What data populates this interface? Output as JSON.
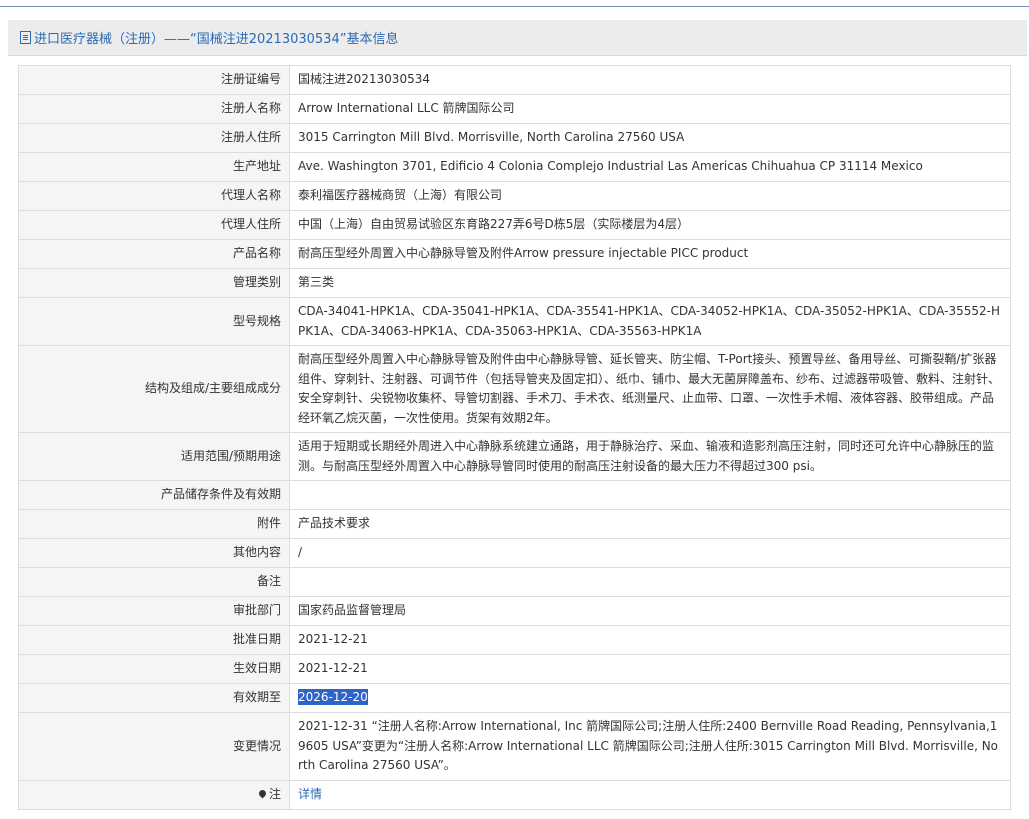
{
  "header": {
    "title": "进口医疗器械（注册）——“国械注进20213030534”基本信息"
  },
  "rows": [
    {
      "label": "注册证编号",
      "value": "国械注进20213030534"
    },
    {
      "label": "注册人名称",
      "value": "Arrow International LLC 箭牌国际公司"
    },
    {
      "label": "注册人住所",
      "value": "3015 Carrington Mill Blvd. Morrisville, North Carolina 27560 USA"
    },
    {
      "label": "生产地址",
      "value": "Ave. Washington 3701, Edificio 4 Colonia Complejo Industrial Las Americas Chihuahua CP 31114 Mexico"
    },
    {
      "label": "代理人名称",
      "value": "泰利福医疗器械商贸（上海）有限公司"
    },
    {
      "label": "代理人住所",
      "value": "中国（上海）自由贸易试验区东育路227弄6号D栋5层（实际楼层为4层）"
    },
    {
      "label": "产品名称",
      "value": "耐高压型经外周置入中心静脉导管及附件Arrow pressure injectable PICC product"
    },
    {
      "label": "管理类别",
      "value": "第三类"
    },
    {
      "label": "型号规格",
      "value": "CDA-34041-HPK1A、CDA-35041-HPK1A、CDA-35541-HPK1A、CDA-34052-HPK1A、CDA-35052-HPK1A、CDA-35552-HPK1A、CDA-34063-HPK1A、CDA-35063-HPK1A、CDA-35563-HPK1A"
    },
    {
      "label": "结构及组成/主要组成成分",
      "value": "耐高压型经外周置入中心静脉导管及附件由中心静脉导管、延长管夹、防尘帽、T-Port接头、预置导丝、备用导丝、可撕裂鞘/扩张器组件、穿刺针、注射器、可调节件（包括导管夹及固定扣）、纸巾、铺巾、最大无菌屏障盖布、纱布、过滤器带吸管、敷料、注射针、安全穿刺针、尖锐物收集杯、导管切割器、手术刀、手术衣、纸测量尺、止血带、口罩、一次性手术帽、液体容器、胶带组成。产品经环氧乙烷灭菌，一次性使用。货架有效期2年。"
    },
    {
      "label": "适用范围/预期用途",
      "value": "适用于短期或长期经外周进入中心静脉系统建立通路，用于静脉治疗、采血、输液和造影剂高压注射，同时还可允许中心静脉压的监测。与耐高压型经外周置入中心静脉导管同时使用的耐高压注射设备的最大压力不得超过300 psi。"
    },
    {
      "label": "产品储存条件及有效期",
      "value": ""
    },
    {
      "label": "附件",
      "value": "产品技术要求"
    },
    {
      "label": "其他内容",
      "value": "/"
    },
    {
      "label": "备注",
      "value": ""
    },
    {
      "label": "审批部门",
      "value": "国家药品监督管理局"
    },
    {
      "label": "批准日期",
      "value": "2021-12-21"
    },
    {
      "label": "生效日期",
      "value": "2021-12-21"
    },
    {
      "label": "有效期至",
      "value": "2026-12-20"
    },
    {
      "label": "变更情况",
      "value": "2021-12-31 “注册人名称:Arrow International, Inc 箭牌国际公司;注册人住所:2400 Bernville Road Reading, Pennsylvania,19605 USA”变更为“注册人名称:Arrow International LLC 箭牌国际公司;注册人住所:3015 Carrington Mill Blvd. Morrisville, North Carolina 27560 USA”。"
    },
    {
      "label": "注",
      "value": "详情"
    }
  ]
}
